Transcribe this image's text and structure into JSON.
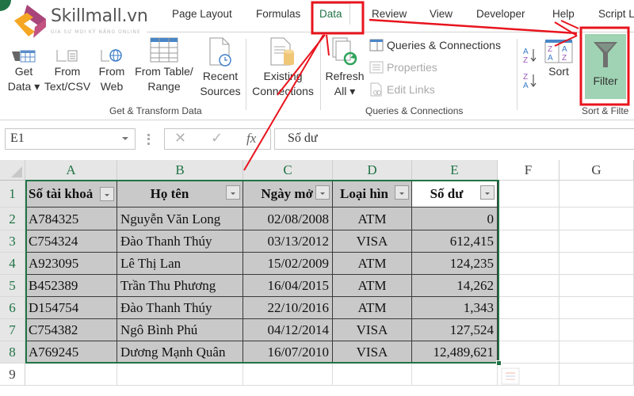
{
  "ribbon": {
    "tabs": [
      {
        "label": "Page Layout",
        "active": false
      },
      {
        "label": "Formulas",
        "active": false
      },
      {
        "label": "Data",
        "active": true
      },
      {
        "label": "Review",
        "active": false
      },
      {
        "label": "View",
        "active": false
      },
      {
        "label": "Developer",
        "active": false
      },
      {
        "label": "Help",
        "active": false
      },
      {
        "label": "Script L",
        "active": false
      }
    ],
    "groups": {
      "get_transform": {
        "label": "Get & Transform Data",
        "buttons": [
          {
            "line1": "Get",
            "line2": "Data ▾",
            "icon": "get-data-icon"
          },
          {
            "line1": "From",
            "line2": "Text/CSV",
            "icon": "text-csv-icon"
          },
          {
            "line1": "From",
            "line2": "Web",
            "icon": "web-icon"
          },
          {
            "line1": "From Table/",
            "line2": "Range",
            "icon": "table-icon"
          },
          {
            "line1": "Recent",
            "line2": "Sources",
            "icon": "recent-sources-icon"
          },
          {
            "line1": "Existing",
            "line2": "Connections",
            "icon": "existing-connections-icon"
          }
        ]
      },
      "queries": {
        "label": "Queries & Connections",
        "refresh": {
          "line1": "Refresh",
          "line2": "All ▾"
        },
        "items": [
          {
            "label": "Queries & Connections",
            "enabled": true
          },
          {
            "label": "Properties",
            "enabled": false
          },
          {
            "label": "Edit Links",
            "enabled": false
          }
        ]
      },
      "sort_filter": {
        "label": "Sort & Filte",
        "sort_label": "Sort",
        "filter_label": "Filter"
      }
    }
  },
  "logo": {
    "name": "Skillmall.vn",
    "tagline": "GIA SƯ MỌI KỸ NĂNG ONLINE"
  },
  "formula_bar": {
    "name_box": "E1",
    "fx_label": "fx",
    "value": "Số dư"
  },
  "sheet": {
    "columns": [
      "A",
      "B",
      "C",
      "D",
      "E",
      "F",
      "G"
    ],
    "rows": [
      "1",
      "2",
      "3",
      "4",
      "5",
      "6",
      "7",
      "8",
      "9"
    ],
    "headers": [
      "Số tài khoả",
      "Họ tên",
      "Ngày mở",
      "Loại hìn",
      "Số dư"
    ],
    "data": [
      [
        "A784325",
        "Nguyễn Văn Long",
        "02/08/2008",
        "ATM",
        "0"
      ],
      [
        "C754324",
        "Đào Thanh Thúy",
        "03/13/2012",
        "VISA",
        "612,415"
      ],
      [
        "A923095",
        "Lê Thị Lan",
        "15/02/2009",
        "ATM",
        "124,235"
      ],
      [
        "B452389",
        "Trần Thu Phương",
        "16/04/2015",
        "ATM",
        "14,262"
      ],
      [
        "D154754",
        " Đào Thanh Thúy",
        "22/10/2016",
        "ATM",
        "1,343"
      ],
      [
        "C754382",
        "Ngô Bình Phú",
        "04/12/2014",
        "VISA",
        "127,524"
      ],
      [
        "A769245",
        "Dương Mạnh Quân",
        "16/07/2010",
        "VISA",
        "12,489,621"
      ]
    ],
    "active_cell": "E1"
  },
  "colors": {
    "excel_green": "#217346",
    "filter_active_bg": "#9fd3b3",
    "annotation_red": "#e8141d",
    "cell_fill": "#c9c9c9"
  }
}
